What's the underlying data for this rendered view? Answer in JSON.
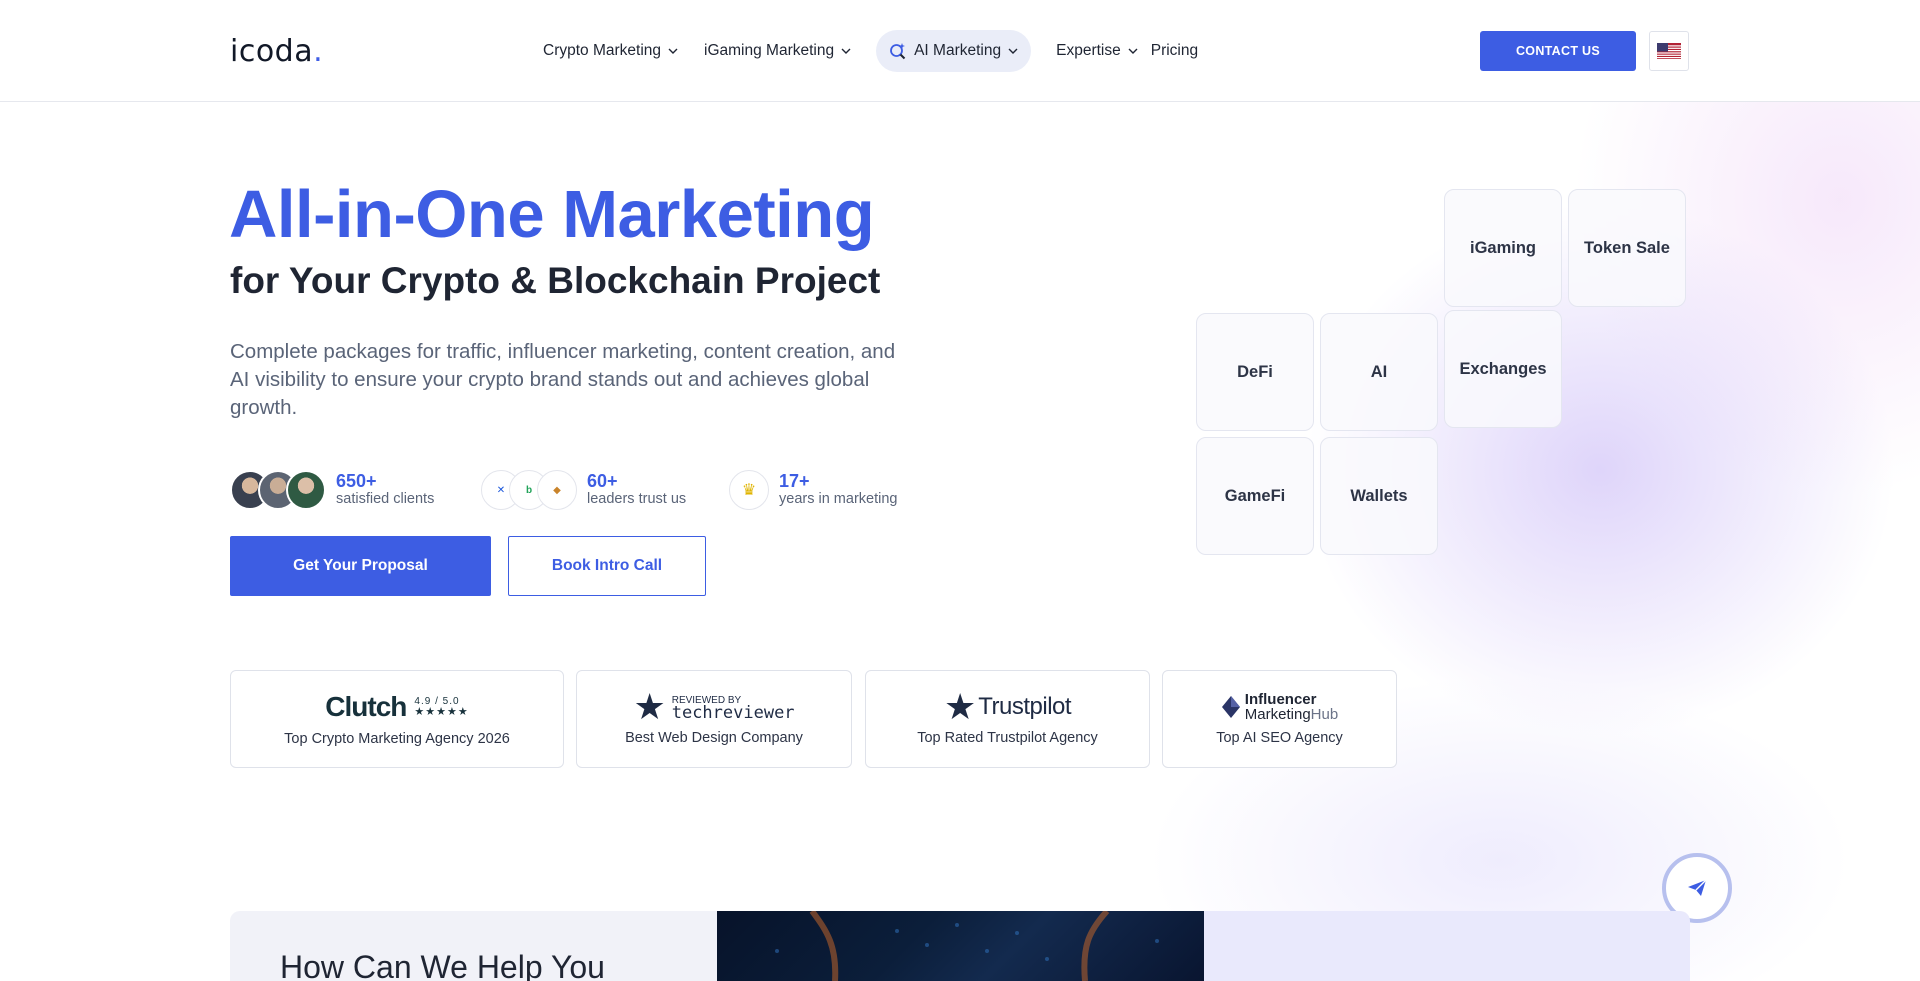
{
  "header": {
    "logo_text": "icoda",
    "logo_dot": ".",
    "nav": [
      {
        "label": "Crypto Marketing",
        "has_dropdown": true
      },
      {
        "label": "iGaming Marketing",
        "has_dropdown": true
      },
      {
        "label": "AI Marketing",
        "has_dropdown": true,
        "active": true
      },
      {
        "label": "Expertise",
        "has_dropdown": true
      },
      {
        "label": "Pricing",
        "has_dropdown": false
      }
    ],
    "contact_label": "CONTACT US",
    "language_icon": "us-flag-icon"
  },
  "hero": {
    "title": "All-in-One Marketing",
    "subtitle": "for Your Crypto & Blockchain Project",
    "lead": "Complete packages for traffic, influencer marketing, content creation, and AI visibility to ensure your crypto brand stands out and achieves global growth.",
    "stats": [
      {
        "value": "650+",
        "label": "satisfied clients"
      },
      {
        "value": "60+",
        "label": "leaders trust us"
      },
      {
        "value": "17+",
        "label": "years in marketing"
      }
    ],
    "primary_cta": "Get Your Proposal",
    "secondary_cta": "Book Intro Call"
  },
  "badges": [
    {
      "logo": "Clutch",
      "rating": "4.9 / 5.0",
      "stars": "★★★★★",
      "caption": "Top Crypto Marketing Agency 2026"
    },
    {
      "logo_small": "REVIEWED BY",
      "logo": "techreviewer",
      "caption": "Best Web Design Company"
    },
    {
      "logo": "Trustpilot",
      "caption": "Top Rated Trustpilot Agency"
    },
    {
      "logo_line1": "Influencer",
      "logo_line2": "Marketing",
      "logo_line2b": "Hub",
      "caption": "Top AI SEO Agency"
    }
  ],
  "tiles": [
    "iGaming",
    "Token Sale",
    "DeFi",
    "AI",
    "Exchanges",
    "GameFi",
    "Wallets"
  ],
  "help": {
    "title": "How Can We Help You"
  },
  "colors": {
    "accent": "#3d5de3",
    "text_dark": "#1f2533",
    "text_muted": "#5a6478"
  }
}
